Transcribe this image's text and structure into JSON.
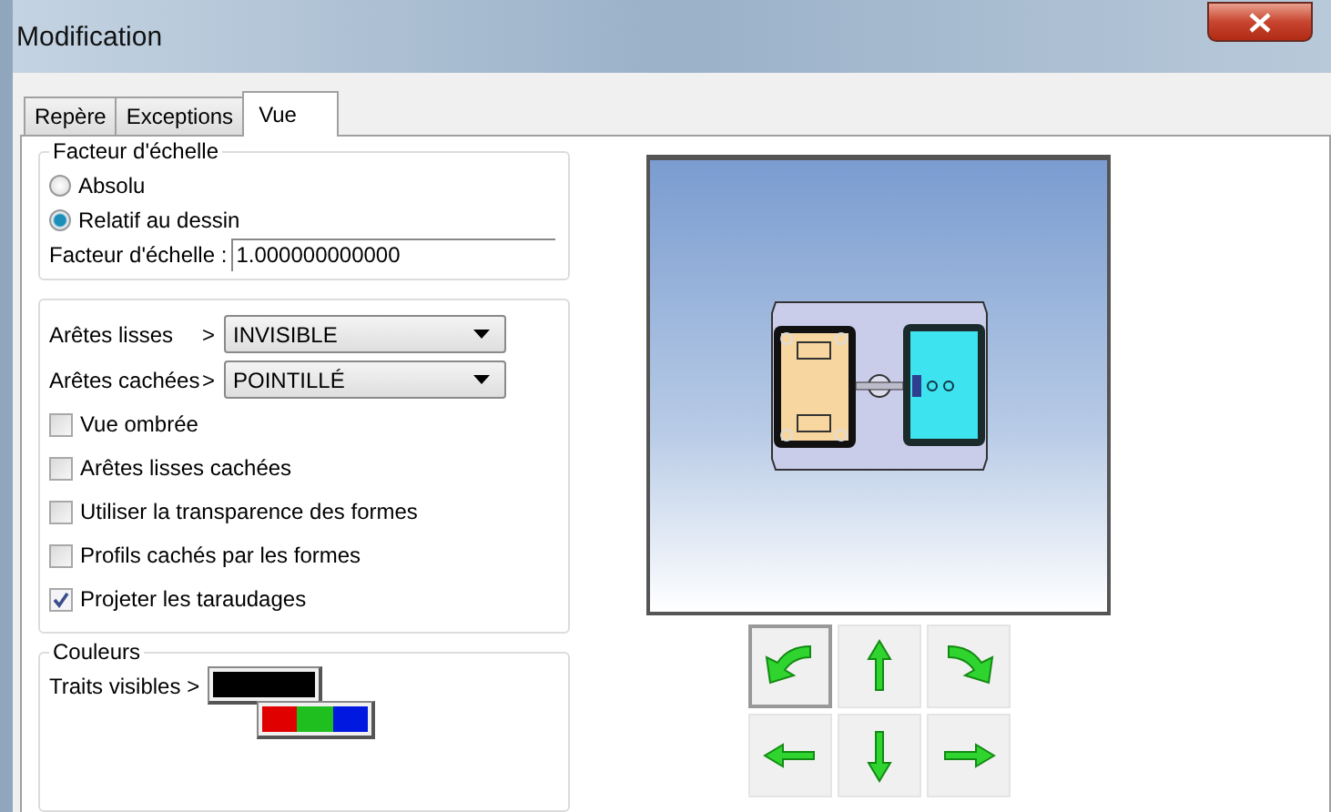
{
  "window": {
    "title": "Modification"
  },
  "tabs": [
    {
      "label": "Repère",
      "selected": false
    },
    {
      "label": "Exceptions",
      "selected": false
    },
    {
      "label": "Vue",
      "selected": true
    }
  ],
  "scale_group": {
    "legend": "Facteur d'échelle",
    "radios": [
      {
        "label": "Absolu",
        "selected": false
      },
      {
        "label": "Relatif au dessin",
        "selected": true
      }
    ],
    "field_label": "Facteur d'échelle :",
    "field_value": "1.000000000000"
  },
  "edges_group": {
    "dropdowns": [
      {
        "label": "Arêtes lisses",
        "arrow": ">",
        "value": "INVISIBLE"
      },
      {
        "label": "Arêtes cachées",
        "arrow": ">",
        "value": "POINTILLÉ"
      }
    ],
    "checkboxes": [
      {
        "label": "Vue ombrée",
        "checked": false
      },
      {
        "label": "Arêtes lisses cachées",
        "checked": false
      },
      {
        "label": "Utiliser la transparence des formes",
        "checked": false
      },
      {
        "label": "Profils cachés par les formes",
        "checked": false
      },
      {
        "label": "Projeter les taraudages",
        "checked": true
      }
    ]
  },
  "colors_group": {
    "legend": "Couleurs",
    "rows": [
      {
        "label": "Traits visibles >",
        "color": "#000000"
      }
    ]
  },
  "rotate_buttons": [
    {
      "kind": "ccw",
      "selected": true
    },
    {
      "kind": "up",
      "selected": false
    },
    {
      "kind": "cw",
      "selected": false
    },
    {
      "kind": "left",
      "selected": false
    },
    {
      "kind": "down",
      "selected": false
    },
    {
      "kind": "right",
      "selected": false
    }
  ]
}
